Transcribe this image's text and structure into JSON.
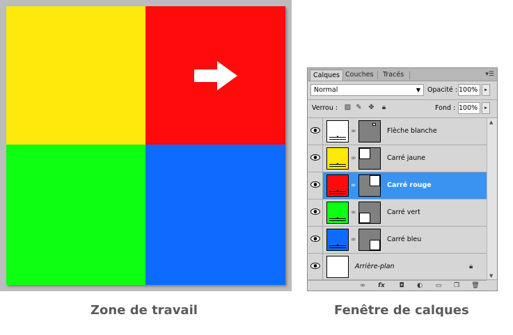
{
  "canvas": {
    "quadrants": [
      {
        "name": "yellow",
        "color": "#ffe80c"
      },
      {
        "name": "red",
        "color": "#ff0b0b"
      },
      {
        "name": "green",
        "color": "#0dff12"
      },
      {
        "name": "blue",
        "color": "#0d6cff"
      }
    ],
    "arrow_color": "#ffffff"
  },
  "captions": {
    "left": "Zone de travail",
    "right": "Fenêtre de calques"
  },
  "panel": {
    "tabs": [
      {
        "label": "Calques",
        "active": true
      },
      {
        "label": "Couches",
        "active": false
      },
      {
        "label": "Tracés",
        "active": false
      }
    ],
    "blend_mode": "Normal",
    "opacity_label": "Opacité :",
    "opacity_value": "100%",
    "lock_label": "Verrou :",
    "fill_label": "Fond :",
    "fill_value": "100%",
    "layers": [
      {
        "name": "Flèche blanche",
        "color": "#ffffff",
        "selected": false
      },
      {
        "name": "Carré jaune",
        "color": "#ffe80c",
        "selected": false
      },
      {
        "name": "Carré rouge",
        "color": "#ff0b0b",
        "selected": true
      },
      {
        "name": "Carré vert",
        "color": "#0dff12",
        "selected": false
      },
      {
        "name": "Carré bleu",
        "color": "#0d6cff",
        "selected": false
      },
      {
        "name": "Arrière-plan",
        "color": "#ffffff",
        "selected": false
      }
    ],
    "selection_color": "#3a93f0",
    "mask_color": "#808080"
  }
}
